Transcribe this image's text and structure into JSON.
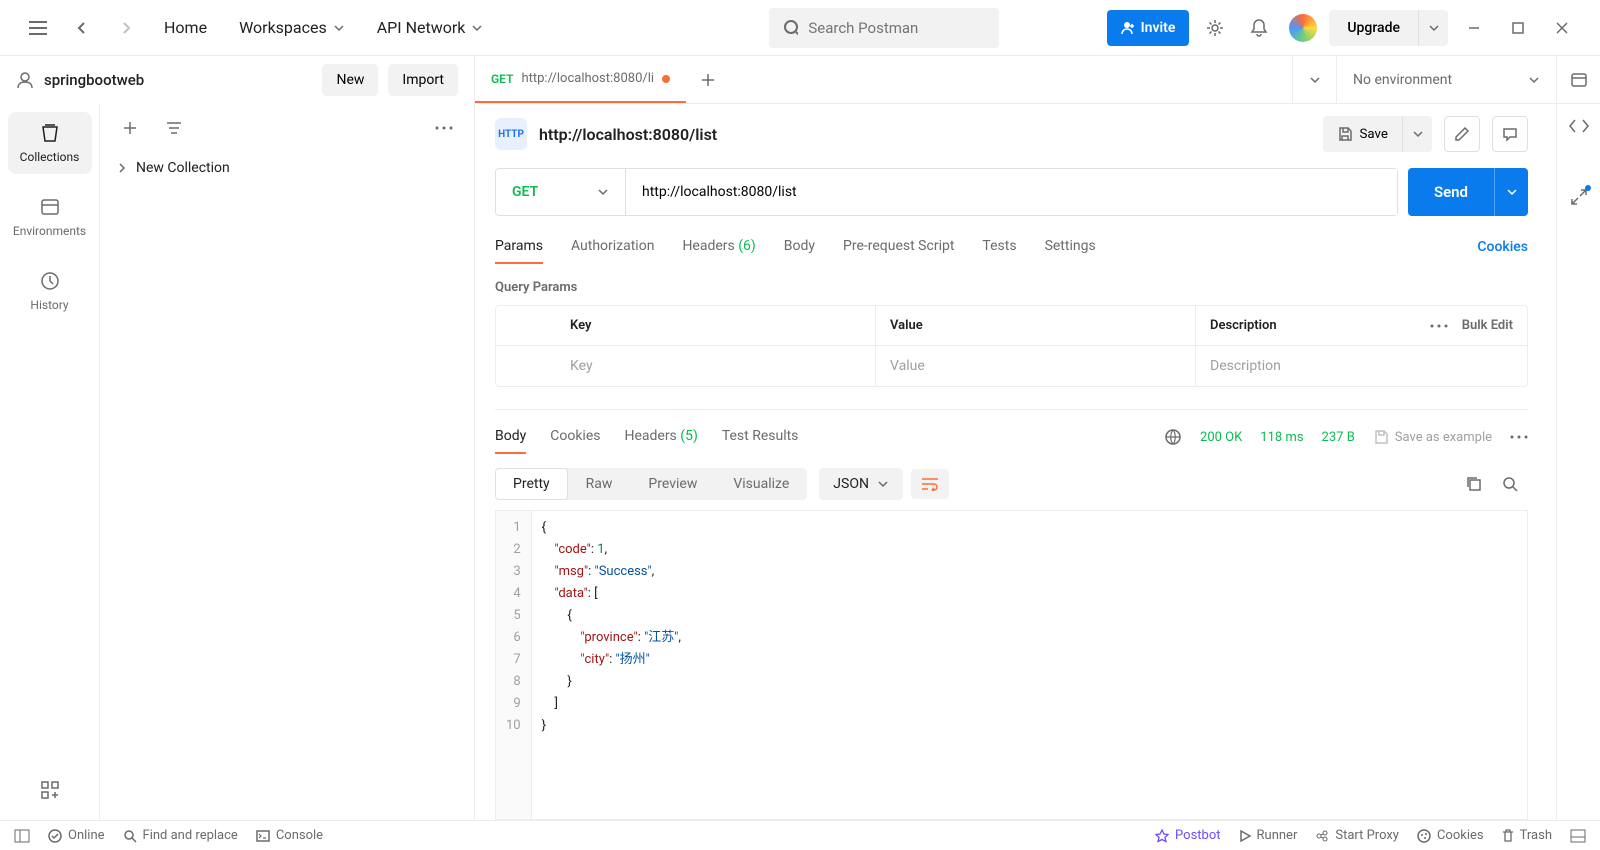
{
  "topbar": {
    "home": "Home",
    "workspaces": "Workspaces",
    "api_network": "API Network",
    "search_placeholder": "Search Postman",
    "invite": "Invite",
    "upgrade": "Upgrade"
  },
  "workspace": {
    "name": "springbootweb",
    "new_btn": "New",
    "import_btn": "Import"
  },
  "sidebar": {
    "collections": "Collections",
    "environments": "Environments",
    "history": "History"
  },
  "tree": {
    "new_collection": "New Collection"
  },
  "tab": {
    "method": "GET",
    "title": "http://localhost:8080/li"
  },
  "env": {
    "none": "No environment"
  },
  "request": {
    "title": "http://localhost:8080/list",
    "save": "Save",
    "method": "GET",
    "url": "http://localhost:8080/list",
    "send": "Send",
    "tabs": {
      "params": "Params",
      "authorization": "Authorization",
      "headers": "Headers",
      "headers_count": "(6)",
      "body": "Body",
      "pre_request": "Pre-request Script",
      "tests": "Tests",
      "settings": "Settings"
    },
    "cookies": "Cookies",
    "query_params": "Query Params",
    "table": {
      "key": "Key",
      "value": "Value",
      "description": "Description",
      "bulk": "Bulk Edit",
      "ph_key": "Key",
      "ph_value": "Value",
      "ph_desc": "Description"
    }
  },
  "response": {
    "tabs": {
      "body": "Body",
      "cookies": "Cookies",
      "headers": "Headers",
      "headers_count": "(5)",
      "test_results": "Test Results"
    },
    "status": "200 OK",
    "time": "118 ms",
    "size": "237 B",
    "save_example": "Save as example",
    "views": {
      "pretty": "Pretty",
      "raw": "Raw",
      "preview": "Preview",
      "visualize": "Visualize"
    },
    "format": "JSON",
    "json": {
      "code": 1,
      "msg": "Success",
      "data": [
        {
          "province": "江苏",
          "city": "扬州"
        }
      ]
    }
  },
  "statusbar": {
    "online": "Online",
    "find": "Find and replace",
    "console": "Console",
    "postbot": "Postbot",
    "runner": "Runner",
    "start_proxy": "Start Proxy",
    "cookies": "Cookies",
    "trash": "Trash"
  }
}
